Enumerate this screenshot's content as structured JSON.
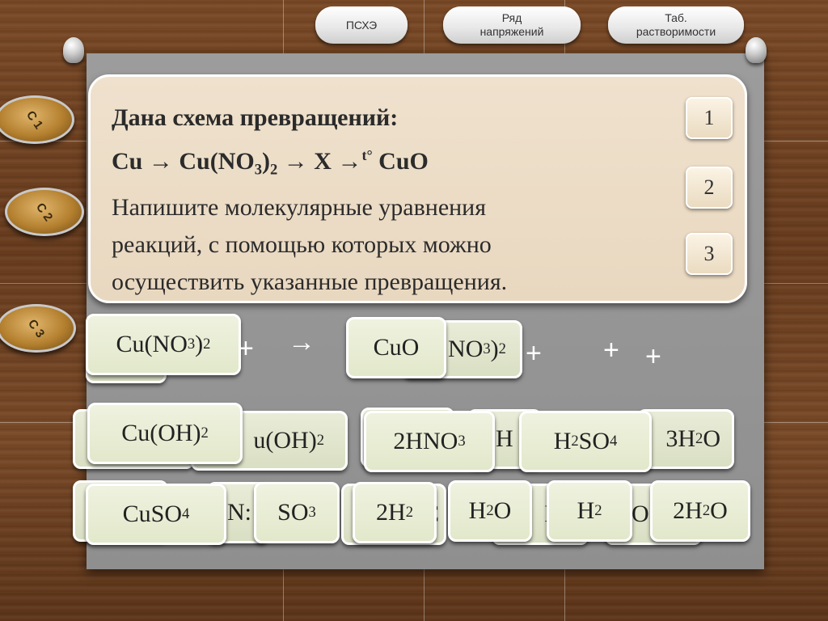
{
  "top_buttons": {
    "pshe": "ПСХЭ",
    "ryad_line1": "Ряд",
    "ryad_line2": "напряжений",
    "tab_line1": "Таб.",
    "tab_line2": "растворимости"
  },
  "task": {
    "heading": "Дана схема превращений:",
    "scheme_part1": "Cu → Cu(NO",
    "scheme_sub1": "3",
    "scheme_part2": ")",
    "scheme_sub2": "2",
    "scheme_part3": " → X →",
    "scheme_sup": "t°",
    "scheme_part4": " CuO",
    "line1": "Напишите молекулярные уравнения",
    "line2": "реакций, с помощью которых можно",
    "line3": "осуществить указанные превращения."
  },
  "step_buttons": [
    "1",
    "2",
    "3"
  ],
  "coins": [
    "C 1",
    "C 2",
    "C 3"
  ],
  "operators": {
    "plus": "+",
    "arrow": "→"
  },
  "answer_row": {
    "tile1_main": "Cu(NO",
    "tile1_sub1": "3",
    "tile1_close": ")",
    "tile1_sub2": "2",
    "tile2": "CuO",
    "hidden_tail": "NO",
    "hidden_tail_sub1": "3",
    "hidden_tail_sub2": "2"
  },
  "bank_row1": {
    "cuoh2_main": "Cu(OH)",
    "cuoh2_sub": "2",
    "partial_oh2": "u(OH)",
    "partial_oh2_sub": "2",
    "hno3_main": "2HNO",
    "hno3_sub": "3",
    "partial_h": "-H",
    "h2so4_a": "H",
    "h2so4_sub1": "2",
    "h2so4_b": "SO",
    "h2so4_sub2": "4",
    "partial_3h2o": "3H",
    "partial_3h2o_sub": "2",
    "partial_3h2o_end": "O"
  },
  "bank_row2": {
    "cuso4_main": "CuSO",
    "cuso4_sub": "4",
    "partial_n": "N:",
    "so3_main": "SO",
    "so3_sub": "3",
    "h2x2_main": "2H",
    "h2x2_sub": "2",
    "partial_c": "C",
    "h2o_a": "H",
    "h2o_sub": "2",
    "h2o_b": "O",
    "partial_h2": "H",
    "h2_main": "H",
    "h2_sub": "2",
    "h2o2_a": "2H",
    "h2o2_sub": "2",
    "h2o2_b": "O"
  }
}
